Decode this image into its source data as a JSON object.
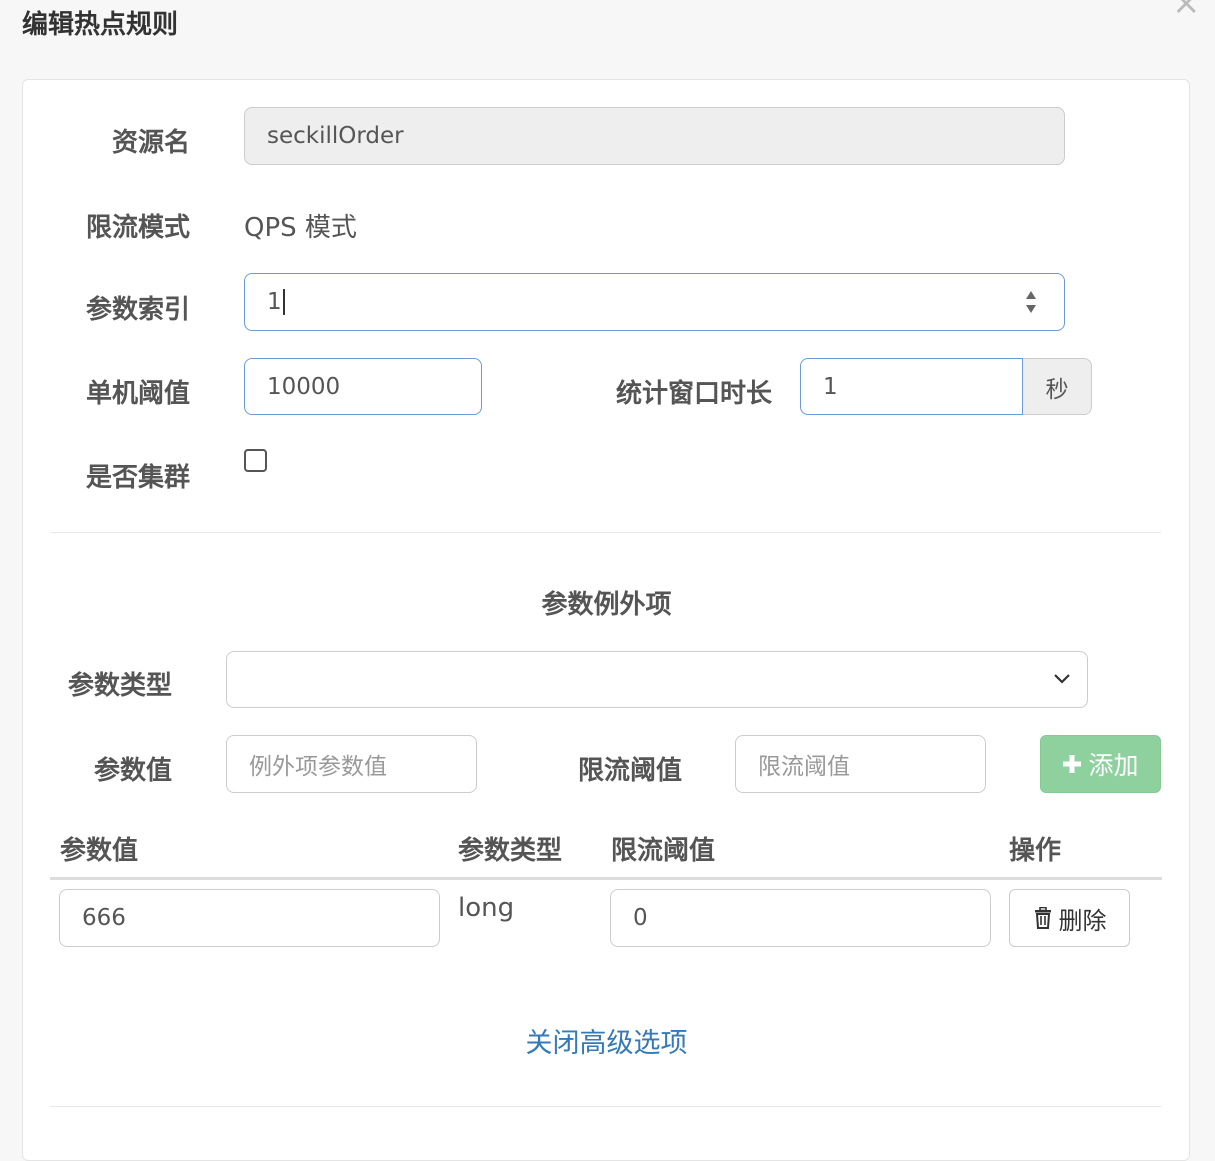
{
  "modal": {
    "title": "编辑热点规则",
    "close_label": "×"
  },
  "form": {
    "resource": {
      "label": "资源名",
      "value": "seckillOrder"
    },
    "mode": {
      "label": "限流模式",
      "value": "QPS 模式"
    },
    "param_index": {
      "label": "参数索引",
      "value": "1"
    },
    "threshold": {
      "label": "单机阈值",
      "value": "10000"
    },
    "window": {
      "label": "统计窗口时长",
      "value": "1",
      "unit": "秒"
    },
    "cluster": {
      "label": "是否集群",
      "checked": false
    }
  },
  "exceptions": {
    "section_title": "参数例外项",
    "param_type": {
      "label": "参数类型",
      "value": ""
    },
    "param_value": {
      "label": "参数值",
      "placeholder": "例外项参数值"
    },
    "limit": {
      "label": "限流阈值",
      "placeholder": "限流阈值"
    },
    "add_button": "添加",
    "table": {
      "headers": [
        "参数值",
        "参数类型",
        "限流阈值",
        "操作"
      ],
      "rows": [
        {
          "value": "666",
          "type": "long",
          "limit": "0",
          "action": "删除"
        }
      ]
    }
  },
  "advanced_toggle": "关闭高级选项",
  "colors": {
    "accent": "#337ab7",
    "add_button": "#8fd19e",
    "focus_border": "#6a9bd8"
  }
}
